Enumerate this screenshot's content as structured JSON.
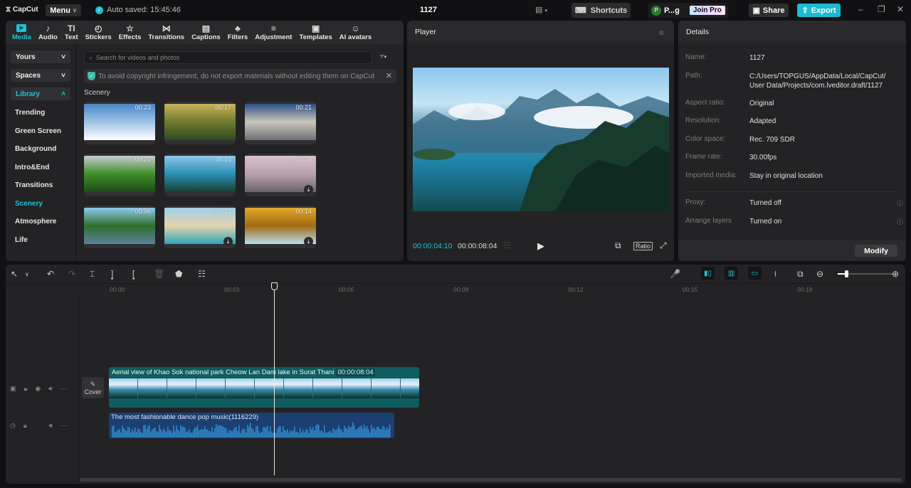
{
  "titlebar": {
    "app_name": "CapCut",
    "menu_label": "Menu",
    "autosave_text": "Auto saved: 15:45:46",
    "project_title": "1127",
    "shortcuts_label": "Shortcuts",
    "user_initial": "P",
    "user_name": "P...g",
    "join_pro_label": "Join Pro",
    "share_label": "Share",
    "export_label": "Export"
  },
  "media_toolbar": [
    {
      "label": "Media",
      "icon": "▶",
      "active": true
    },
    {
      "label": "Audio",
      "icon": "♪"
    },
    {
      "label": "Text",
      "icon": "TI"
    },
    {
      "label": "Stickers",
      "icon": "◴"
    },
    {
      "label": "Effects",
      "icon": "☆"
    },
    {
      "label": "Transitions",
      "icon": "⋈"
    },
    {
      "label": "Captions",
      "icon": "▤"
    },
    {
      "label": "Filters",
      "icon": "♣"
    },
    {
      "label": "Adjustment",
      "icon": "≡"
    },
    {
      "label": "Templates",
      "icon": "▣"
    },
    {
      "label": "AI avatars",
      "icon": "☺"
    }
  ],
  "sidebar": {
    "dropdowns": [
      {
        "label": "Yours",
        "chevron": "˅"
      },
      {
        "label": "Spaces",
        "chevron": "˅"
      },
      {
        "label": "Library",
        "chevron": "˄"
      }
    ],
    "items": [
      "Trending",
      "Green Screen",
      "Background",
      "Intro&End",
      "Transitions",
      "Scenery",
      "Atmosphere",
      "Life"
    ],
    "active_item": "Scenery"
  },
  "library": {
    "search_placeholder": "Search for videos and photos",
    "notice": "To avoid copyright infringement, do not export materials without editing them on CapCut",
    "section_title": "Scenery",
    "thumbnails": [
      {
        "duration": "00:23",
        "downloadable": false,
        "colors": [
          "#4a86c6",
          "#9fc3e6",
          "#ffffff"
        ]
      },
      {
        "duration": "00:17",
        "downloadable": false,
        "colors": [
          "#c9b45a",
          "#6e7a2e",
          "#2e4a20"
        ]
      },
      {
        "duration": "00:21",
        "downloadable": false,
        "colors": [
          "#2d4f86",
          "#c9c6bc",
          "#6f6f75"
        ]
      },
      {
        "duration": "00:21",
        "downloadable": false,
        "colors": [
          "#c9ccd2",
          "#3f8f2a",
          "#1c4a17"
        ]
      },
      {
        "duration": "00:10",
        "downloadable": false,
        "colors": [
          "#8fc7ea",
          "#2a8fb3",
          "#163f30"
        ]
      },
      {
        "duration": "00:28",
        "downloadable": true,
        "colors": [
          "#d7c3cb",
          "#b8a0ae",
          "#6c6466"
        ]
      },
      {
        "duration": "00:06",
        "downloadable": false,
        "colors": [
          "#8fcaf0",
          "#2f6e2a",
          "#5d7f9e"
        ]
      },
      {
        "duration": "00:31",
        "downloadable": true,
        "colors": [
          "#9fd0ea",
          "#e6d3ad",
          "#2aa6b9"
        ]
      },
      {
        "duration": "00:14",
        "downloadable": true,
        "colors": [
          "#e2a82a",
          "#a06a12",
          "#b8dff0"
        ]
      }
    ]
  },
  "player": {
    "title": "Player",
    "current_time": "00:00:04:10",
    "total_time": "00:00:08:04",
    "ratio_label": "Ratio"
  },
  "details": {
    "title": "Details",
    "rows": [
      {
        "label": "Name:",
        "value": "1127"
      },
      {
        "label": "Path:",
        "value": "C:/Users/TOPGUS/AppData/Local/CapCut/",
        "value2": "User Data/Projects/com.lveditor.draft/1127"
      },
      {
        "label": "Aspect ratio:",
        "value": "Original"
      },
      {
        "label": "Resolution:",
        "value": "Adapted"
      },
      {
        "label": "Color space:",
        "value": "Rec. 709 SDR"
      },
      {
        "label": "Frame rate:",
        "value": "30.00fps"
      },
      {
        "label": "Imported media:",
        "value": "Stay in original location"
      }
    ],
    "extra_rows": [
      {
        "label": "Proxy:",
        "value": "Turned off"
      },
      {
        "label": "Arrange layers",
        "value": "Turned on"
      }
    ],
    "modify_label": "Modify"
  },
  "timeline": {
    "ruler_ticks": [
      "00:00",
      "00:03",
      "00:06",
      "00:09",
      "00:12",
      "00:15",
      "00:18"
    ],
    "zoom_level": 0.15,
    "cover_label": "Cover",
    "video_clip": {
      "title": "Aerial view of Khao Sok national park Cheow Lan Dam lake in Surat Thani",
      "duration": "00:00:08:04"
    },
    "audio_clip": {
      "title": "The most fashionable dance pop music(1116229)"
    }
  }
}
